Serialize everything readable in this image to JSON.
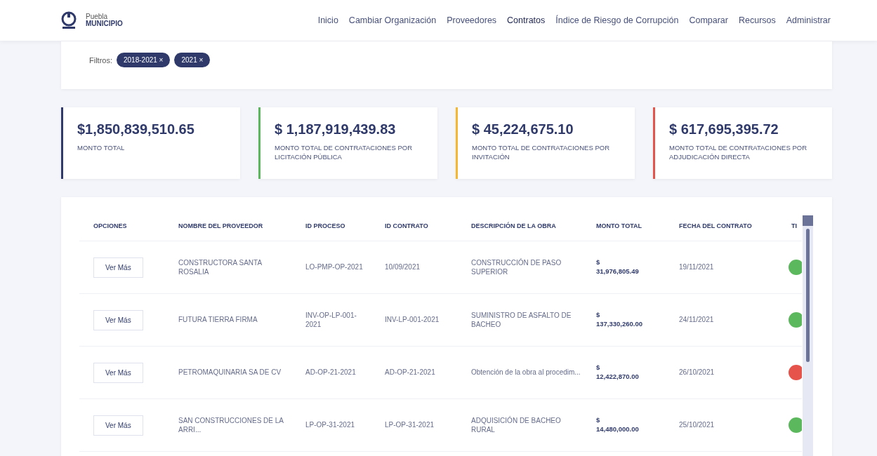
{
  "header": {
    "logo_lines": [
      "Puebla",
      "MUNICIPIO"
    ],
    "nav": [
      {
        "label": "Inicio",
        "selected": false
      },
      {
        "label": "Cambiar Organización",
        "selected": false
      },
      {
        "label": "Proveedores",
        "selected": false
      },
      {
        "label": "Contratos",
        "selected": true
      },
      {
        "label": "Índice de Riesgo de Corrupción",
        "selected": false
      },
      {
        "label": "Comparar",
        "selected": false
      },
      {
        "label": "Recursos",
        "selected": false
      },
      {
        "label": "Administrar",
        "selected": false
      }
    ]
  },
  "filters": {
    "label": "Filtros:",
    "chips": [
      {
        "label": "2018-2021",
        "remove": "×"
      },
      {
        "label": "2021",
        "remove": "×"
      }
    ]
  },
  "cards": [
    {
      "amount": "$1,850,839,510.65",
      "caption": "MONTO TOTAL",
      "color": "#2f3a6b"
    },
    {
      "amount": "$ 1,187,919,439.83",
      "caption": "MONTO TOTAL DE CONTRATACIONES POR LICITACIÓN PÚBLICA",
      "color": "#5cb85c"
    },
    {
      "amount": "$ 45,224,675.10",
      "caption": "MONTO TOTAL DE CONTRATACIONES POR INVITACIÓN",
      "color": "#f5b731"
    },
    {
      "amount": "$ 617,695,395.72",
      "caption": "MONTO TOTAL DE CONTRATACIONES POR ADJUDICACIÓN DIRECTA",
      "color": "#e5534b"
    }
  ],
  "table": {
    "columns": [
      "OPCIONES",
      "NOMBRE DEL PROVEEDOR",
      "ID PROCESO",
      "ID CONTRATO",
      "DESCRIPCIÓN DE LA OBRA",
      "MONTO TOTAL",
      "FECHA DEL CONTRATO",
      "TI"
    ],
    "rows": [
      {
        "action": "Ver Más",
        "provider": "CONSTRUCTORA SANTA ROSALIA",
        "process": "LO-PMP-OP-2021",
        "contract": "10/09/2021",
        "description": "CONSTRUCCIÓN DE PASO SUPERIOR",
        "currency": "$",
        "amount": "31,976,805.49",
        "date": "19/11/2021",
        "color": "#5cb85c"
      },
      {
        "action": "Ver Más",
        "provider": "FUTURA TIERRA FIRMA",
        "process": "INV-OP-LP-001-2021",
        "contract": "INV-LP-001-2021",
        "description": "SUMINISTRO DE ASFALTO DE BACHEO",
        "currency": "$",
        "amount": "137,330,260.00",
        "date": "24/11/2021",
        "color": "#5cb85c"
      },
      {
        "action": "Ver Más",
        "provider": "PETROMAQUINARIA SA DE CV",
        "process": "AD-OP-21-2021",
        "contract": "AD-OP-21-2021",
        "description": "Obtención de la obra al procedim...",
        "currency": "$",
        "amount": "12,422,870.00",
        "date": "26/10/2021",
        "color": "#e5534b"
      },
      {
        "action": "Ver Más",
        "provider": "SAN CONSTRUCCIONES DE LA ARRI...",
        "process": "LP-OP-31-2021",
        "contract": "LP-OP-31-2021",
        "description": "ADQUISICIÓN DE BACHEO RURAL",
        "currency": "$",
        "amount": "14,480,000.00",
        "date": "25/10/2021",
        "color": "#5cb85c"
      }
    ]
  }
}
